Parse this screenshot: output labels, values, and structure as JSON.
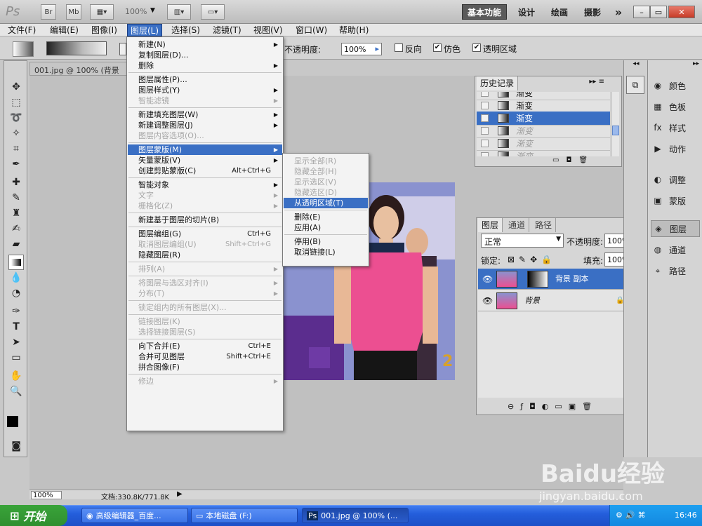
{
  "appbar": {
    "logo": "Ps",
    "br": "Br",
    "mb": "Mb",
    "zoom": "100%",
    "workspaces": [
      "基本功能",
      "设计",
      "绘画",
      "摄影"
    ],
    "more": "»",
    "win_min": "–",
    "win_max": "▭",
    "win_close": "✕"
  },
  "menubar": [
    "文件(F)",
    "编辑(E)",
    "图像(I)",
    "图层(L)",
    "选择(S)",
    "滤镜(T)",
    "视图(V)",
    "窗口(W)",
    "帮助(H)"
  ],
  "options": {
    "opacity_label": "不透明度:",
    "opacity_value": "100%",
    "reverse": "反向",
    "dither": "仿色",
    "transparency": "透明区域"
  },
  "doc_tab": "001.jpg @ 100% (背景",
  "layer_menu": [
    {
      "label": "新建(N)",
      "arrow": true
    },
    {
      "label": "复制图层(D)..."
    },
    {
      "label": "删除",
      "arrow": true
    },
    {
      "sep": true
    },
    {
      "label": "图层属性(P)..."
    },
    {
      "label": "图层样式(Y)",
      "arrow": true
    },
    {
      "label": "智能滤镜",
      "arrow": true,
      "disabled": true
    },
    {
      "sep": true
    },
    {
      "label": "新建填充图层(W)",
      "arrow": true
    },
    {
      "label": "新建调整图层(J)",
      "arrow": true
    },
    {
      "label": "图层内容选项(O)...",
      "disabled": true
    },
    {
      "sep": true
    },
    {
      "label": "图层蒙版(M)",
      "arrow": true,
      "highlight": true
    },
    {
      "label": "矢量蒙版(V)",
      "arrow": true
    },
    {
      "label": "创建剪贴蒙版(C)",
      "shortcut": "Alt+Ctrl+G"
    },
    {
      "sep": true
    },
    {
      "label": "智能对象",
      "arrow": true
    },
    {
      "label": "文字",
      "arrow": true,
      "disabled": true
    },
    {
      "label": "栅格化(Z)",
      "arrow": true,
      "disabled": true
    },
    {
      "sep": true
    },
    {
      "label": "新建基于图层的切片(B)"
    },
    {
      "sep": true
    },
    {
      "label": "图层编组(G)",
      "shortcut": "Ctrl+G"
    },
    {
      "label": "取消图层编组(U)",
      "shortcut": "Shift+Ctrl+G",
      "disabled": true
    },
    {
      "label": "隐藏图层(R)"
    },
    {
      "sep": true
    },
    {
      "label": "排列(A)",
      "arrow": true,
      "disabled": true
    },
    {
      "sep": true
    },
    {
      "label": "将图层与选区对齐(I)",
      "arrow": true,
      "disabled": true
    },
    {
      "label": "分布(T)",
      "arrow": true,
      "disabled": true
    },
    {
      "sep": true
    },
    {
      "label": "锁定组内的所有图层(X)...",
      "disabled": true
    },
    {
      "sep": true
    },
    {
      "label": "链接图层(K)",
      "disabled": true
    },
    {
      "label": "选择链接图层(S)",
      "disabled": true
    },
    {
      "sep": true
    },
    {
      "label": "向下合并(E)",
      "shortcut": "Ctrl+E"
    },
    {
      "label": "合并可见图层",
      "shortcut": "Shift+Ctrl+E"
    },
    {
      "label": "拼合图像(F)"
    },
    {
      "sep": true
    },
    {
      "label": "修边",
      "arrow": true,
      "disabled": true
    }
  ],
  "mask_submenu": [
    {
      "label": "显示全部(R)",
      "disabled": true
    },
    {
      "label": "隐藏全部(H)",
      "disabled": true
    },
    {
      "label": "显示选区(V)",
      "disabled": true
    },
    {
      "label": "隐藏选区(D)",
      "disabled": true
    },
    {
      "label": "从透明区域(T)",
      "disabled": true,
      "highlight": true
    },
    {
      "sep": true
    },
    {
      "label": "删除(E)"
    },
    {
      "label": "应用(A)"
    },
    {
      "sep": true
    },
    {
      "label": "停用(B)"
    },
    {
      "label": "取消链接(L)"
    }
  ],
  "history": {
    "tab": "历史记录",
    "rows": [
      {
        "label": "渐变",
        "state": "partial"
      },
      {
        "label": "渐变",
        "state": "normal"
      },
      {
        "label": "渐变",
        "state": "selected"
      },
      {
        "label": "渐变",
        "state": "gray"
      },
      {
        "label": "渐变",
        "state": "gray"
      },
      {
        "label": "渐变",
        "state": "gray"
      }
    ]
  },
  "layers": {
    "tabs": [
      "图层",
      "通道",
      "路径"
    ],
    "blend": "正常",
    "opacity_label": "不透明度:",
    "opacity_value": "100%",
    "lock_label": "锁定:",
    "fill_label": "填充:",
    "fill_value": "100%",
    "rows": [
      {
        "name": "背景 副本",
        "selected": true
      },
      {
        "name": "背景",
        "selected": false
      }
    ]
  },
  "dock": [
    {
      "label": "颜色",
      "icon": "◉"
    },
    {
      "label": "色板",
      "icon": "▦"
    },
    {
      "label": "样式",
      "icon": "fx"
    },
    {
      "label": "动作",
      "icon": "▶"
    },
    {
      "label": "调整",
      "icon": "◐"
    },
    {
      "label": "蒙版",
      "icon": "▣"
    },
    {
      "label": "图层",
      "icon": "◈",
      "on": true
    },
    {
      "label": "通道",
      "icon": "◍"
    },
    {
      "label": "路径",
      "icon": "⌖"
    }
  ],
  "status": {
    "zoom": "100%",
    "doc": "文档:330.8K/771.8K"
  },
  "taskbar": {
    "start": "开始",
    "tasks": [
      "高级编辑器_百度...",
      "本地磁盘 (F:)",
      "001.jpg @ 100% (..."
    ],
    "clock": "16:46"
  },
  "watermark": {
    "brand": "Baidu经验",
    "url": "jingyan.baidu.com"
  },
  "colors": {
    "highlight": "#3a6fc4",
    "taskbar": "#245edb",
    "start": "#2f8f2f",
    "pink": "#e8508e"
  }
}
